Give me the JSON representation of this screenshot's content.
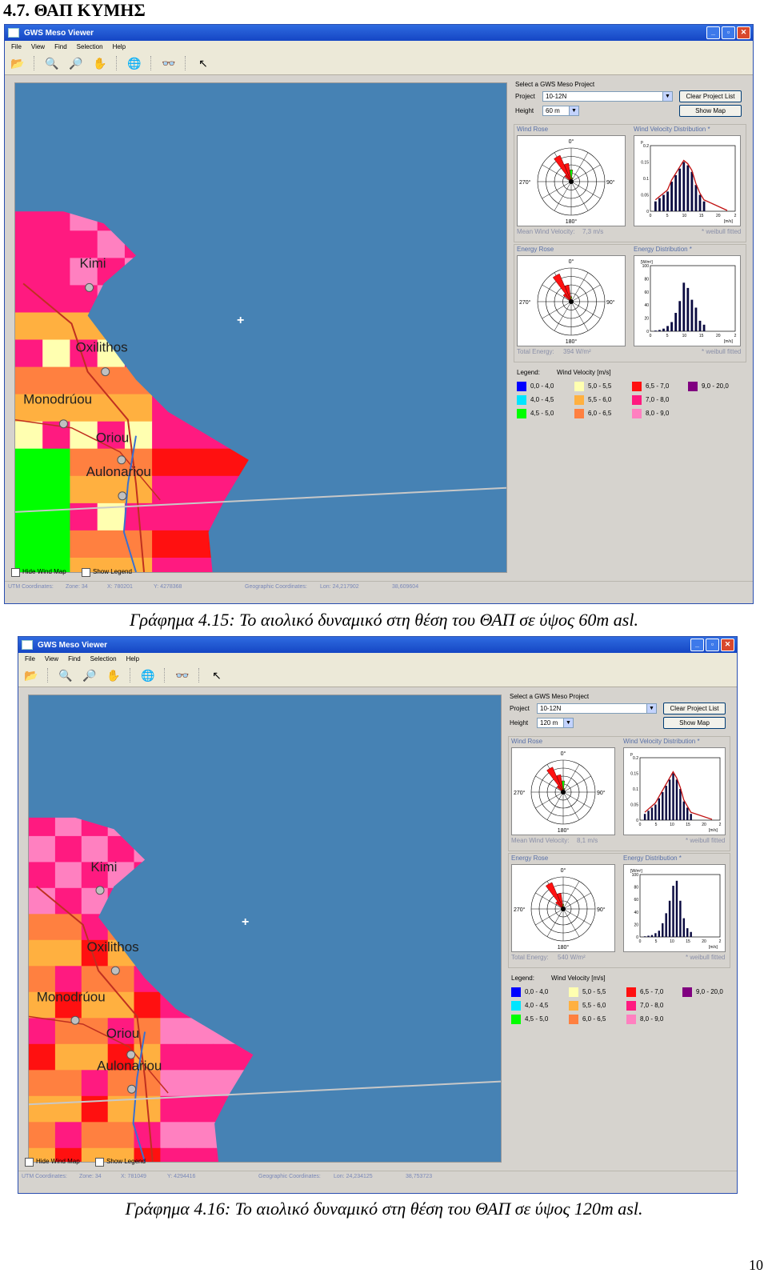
{
  "heading": "4.7. ΘΑΠ ΚΥΜΗΣ",
  "captions": {
    "fig1": "Γράφημα 4.15: Το αιολικό δυναμικό στη θέση του ΘΑΠ σε ύψος 60m asl.",
    "fig2": "Γράφημα 4.16: Το αιολικό δυναμικό στη θέση του ΘΑΠ σε ύψος 120m asl."
  },
  "page_number": "10",
  "app": {
    "title": "GWS Meso Viewer",
    "menu": [
      "File",
      "View",
      "Find",
      "Selection",
      "Help"
    ],
    "select_heading": "Select a GWS Meso Project",
    "project_label": "Project",
    "height_label": "Height",
    "clear_button": "Clear Project List",
    "show_button": "Show Map",
    "wind_rose_title": "Wind Rose",
    "wvd_title": "Wind Velocity Distribution *",
    "energy_rose_title": "Energy Rose",
    "energy_dist_title": "Energy Distribution *",
    "mean_wind_label": "Mean Wind Velocity:",
    "total_energy_label": "Total Energy:",
    "weibull_note": "* weibull fitted",
    "compass": {
      "n": "0°",
      "e": "90°",
      "s": "180°",
      "w": "270°"
    },
    "wvd_ylabel": "p",
    "wvd_yticks": [
      "0.2",
      "0.15",
      "0.1",
      "0.05",
      "0"
    ],
    "wvd_xticks": [
      "0",
      "5",
      "10",
      "15",
      "20",
      "2"
    ],
    "wvd_unit": "[m/s]",
    "ed_ylabel": "[W/m²]",
    "ed_yticks": [
      "100",
      "80",
      "60",
      "40",
      "20",
      "0"
    ],
    "ed_xticks": [
      "0",
      "5",
      "10",
      "15",
      "20",
      "2"
    ],
    "ed_unit": "[m/s]",
    "legend_label": "Legend:",
    "legend_title": "Wind Velocity [m/s]",
    "legend": [
      {
        "range": "0,0 - 4,0",
        "color": "#0000ff"
      },
      {
        "range": "4,0 - 4,5",
        "color": "#00e5ff"
      },
      {
        "range": "4,5 - 5,0",
        "color": "#00ff00"
      },
      {
        "range": "5,0 - 5,5",
        "color": "#ffffb0"
      },
      {
        "range": "5,5 - 6,0",
        "color": "#ffb040"
      },
      {
        "range": "6,0 - 6,5",
        "color": "#ff8040"
      },
      {
        "range": "6,5 - 7,0",
        "color": "#ff1010"
      },
      {
        "range": "7,0 - 8,0",
        "color": "#ff1a80"
      },
      {
        "range": "8,0 - 9,0",
        "color": "#ff80c0"
      },
      {
        "range": "9,0 - 20,0",
        "color": "#800080"
      }
    ],
    "hide_wind_map": "Hide Wind Map",
    "show_legend": "Show Legend",
    "utm_label": "UTM Coordinates:",
    "zone": "Zone: 34",
    "geo_label": "Geographic Coordinates:"
  },
  "views": [
    {
      "project": "10-12N",
      "height": "60 m",
      "mean_wind": "7,3 m/s",
      "total_energy": "394 W/m²",
      "x": "X: 780201",
      "y": "Y: 4278368",
      "lon": "Lon: 24,217902",
      "lat": "38,609604",
      "place_names": [
        "Kimi",
        "Oxilithos",
        "Monodrúou",
        "Oriou",
        "Aulonariou"
      ],
      "wvd_bars": [
        0.03,
        0.04,
        0.05,
        0.06,
        0.09,
        0.11,
        0.13,
        0.15,
        0.14,
        0.12,
        0.08,
        0.05,
        0.03
      ],
      "ed_bars": [
        1,
        2,
        4,
        8,
        14,
        28,
        46,
        74,
        66,
        48,
        36,
        16,
        10
      ]
    },
    {
      "project": "10-12N",
      "height": "120 m",
      "mean_wind": "8,1 m/s",
      "total_energy": "540 W/m²",
      "x": "X: 781049",
      "y": "Y: 4294416",
      "lon": "Lon: 24,234125",
      "lat": "38,753723",
      "place_names": [
        "Kimi",
        "Oxilithos",
        "Monodrúou",
        "Oriou",
        "Aulonariou"
      ],
      "wvd_bars": [
        0.02,
        0.03,
        0.04,
        0.05,
        0.07,
        0.09,
        0.11,
        0.13,
        0.15,
        0.13,
        0.1,
        0.06,
        0.04,
        0.02
      ],
      "ed_bars": [
        1,
        2,
        3,
        6,
        10,
        22,
        38,
        58,
        82,
        90,
        58,
        30,
        14,
        8
      ]
    }
  ]
}
